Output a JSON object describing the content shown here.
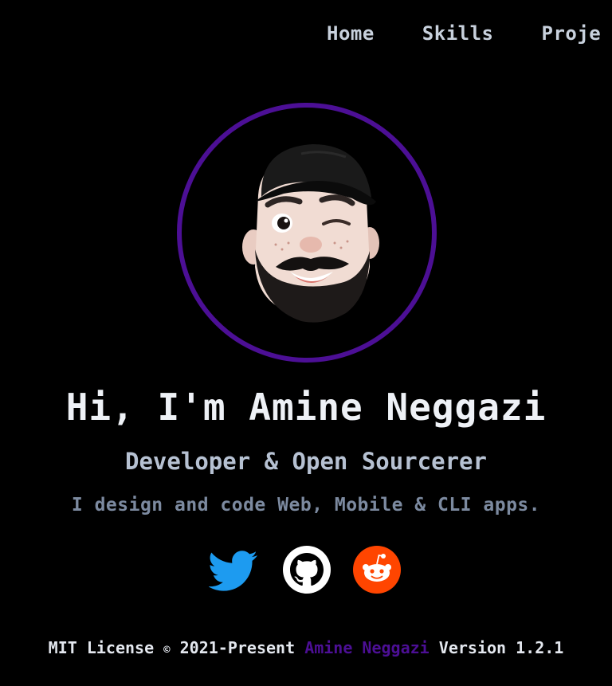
{
  "nav": {
    "items": [
      {
        "label": "Home"
      },
      {
        "label": "Skills"
      },
      {
        "label": "Proje"
      }
    ]
  },
  "hero": {
    "title": "Hi, I'm Amine Neggazi",
    "subtitle": "Developer & Open Sourcerer",
    "tagline": "I design and code Web, Mobile & CLI apps."
  },
  "social": [
    {
      "icon": "twitter-icon",
      "color": "#1d9bf0"
    },
    {
      "icon": "github-icon",
      "color": "#ffffff"
    },
    {
      "icon": "reddit-icon",
      "color": "#ff4500"
    }
  ],
  "footer": {
    "license": "MIT License",
    "copyright_symbol": "©",
    "years": "2021-Present",
    "author": "Amine Neggazi",
    "version": "Version 1.2.1"
  },
  "colors": {
    "background": "#000000",
    "accent": "#4c0f95",
    "nav_text": "#c8d1dd",
    "title_text": "#eef1f6",
    "subtitle_text": "#b6c1d2",
    "tagline_text": "#7c8aa0"
  }
}
